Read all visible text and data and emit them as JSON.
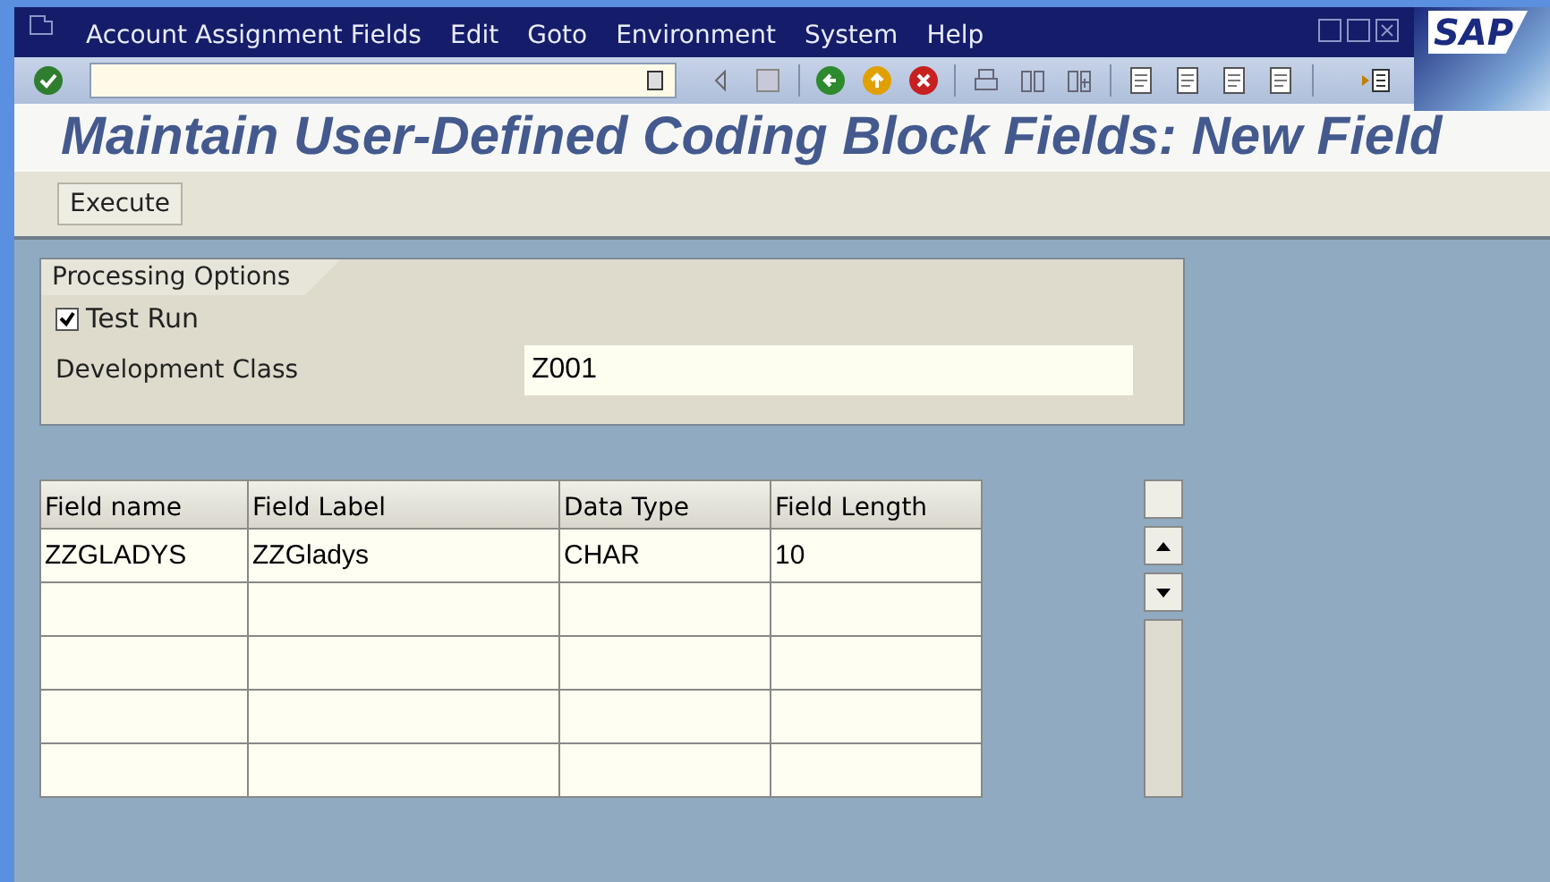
{
  "window": {
    "logo": "SAP"
  },
  "menu": [
    {
      "label": "Account Assignment Fields"
    },
    {
      "label": "Edit"
    },
    {
      "label": "Goto"
    },
    {
      "label": "Environment"
    },
    {
      "label": "System"
    },
    {
      "label": "Help"
    }
  ],
  "title": "Maintain User-Defined Coding Block Fields: New Field",
  "app_toolbar": {
    "buttons": [
      "Execute"
    ]
  },
  "processing_options": {
    "title": "Processing Options",
    "test_run": {
      "label": "Test Run",
      "checked": true
    },
    "development_class": {
      "label": "Development Class",
      "value": "Z001"
    }
  },
  "table": {
    "columns": [
      "Field name",
      "Field Label",
      "Data Type",
      "Field Length"
    ],
    "rows": [
      [
        "ZZGLADYS",
        "ZZGladys",
        "CHAR",
        "10"
      ]
    ]
  }
}
